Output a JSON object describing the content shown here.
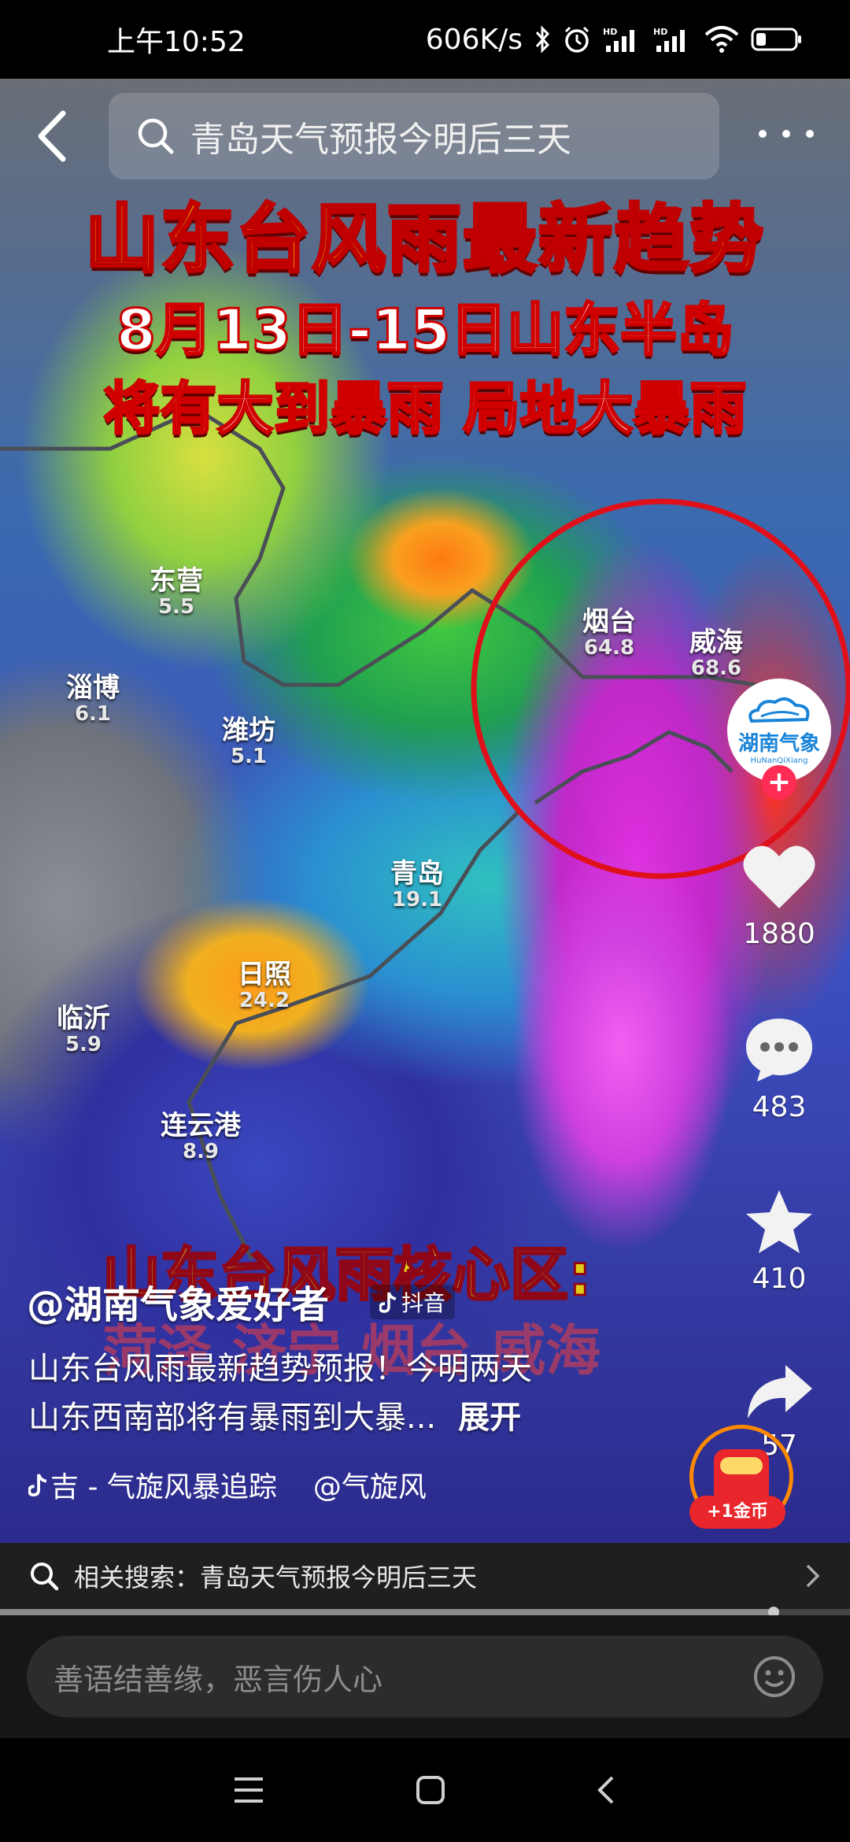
{
  "status_bar": {
    "time": "上午10:52",
    "net_speed": "606K/s",
    "icons": [
      "bluetooth-icon",
      "alarm-icon",
      "signal-hd-1-icon",
      "signal-hd-2-icon",
      "wifi-icon",
      "battery-icon"
    ]
  },
  "top_bar": {
    "search_query": "青岛天气预报今明后三天",
    "icons": [
      "back-icon",
      "search-icon",
      "more-icon"
    ]
  },
  "video": {
    "title_line1": "山东台风雨最新趋势",
    "title_line2": "8月13日-15日山东半岛",
    "title_line3": "将有大到暴雨 局地大暴雨",
    "cities": [
      {
        "name": "东营",
        "value": "5.5"
      },
      {
        "name": "淄博",
        "value": "6.1"
      },
      {
        "name": "潍坊",
        "value": "5.1"
      },
      {
        "name": "烟台",
        "value": "64.8"
      },
      {
        "name": "威海",
        "value": "68.6"
      },
      {
        "name": "青岛",
        "value": "19.1"
      },
      {
        "name": "日照",
        "value": "24.2"
      },
      {
        "name": "临沂",
        "value": "5.9"
      },
      {
        "name": "连云港",
        "value": "8.9"
      }
    ],
    "core_line1": "山东台风雨核心区:",
    "core_line2": "菏泽 济宁 烟台 威海"
  },
  "side_actions": {
    "avatar_logo": "湖南气象",
    "avatar_logo_sub": "HuNanQiXiang",
    "likes": "1880",
    "comments": "483",
    "favorites": "410",
    "shares": "57"
  },
  "caption": {
    "author": "@湖南气象爱好者",
    "platform_badge": "抖音",
    "description_line1": "山东台风雨最新趋势预报！今明两天",
    "description_line2": "山东西南部将有暴雨到大暴...",
    "expand_label": "展开",
    "music_text": "吉 - 气旋风暴追踪",
    "music_author": "@气旋风",
    "coin_label": "+1金币"
  },
  "related_search": {
    "label": "相关搜索：青岛天气预报今明后三天",
    "progress": 0.91
  },
  "comment_bar": {
    "placeholder": "善语结善缘，恶言伤人心"
  },
  "colors": {
    "accent_red": "#ff2c55",
    "title_yellow": "#ffe600",
    "coin_orange": "#ff8a00"
  }
}
